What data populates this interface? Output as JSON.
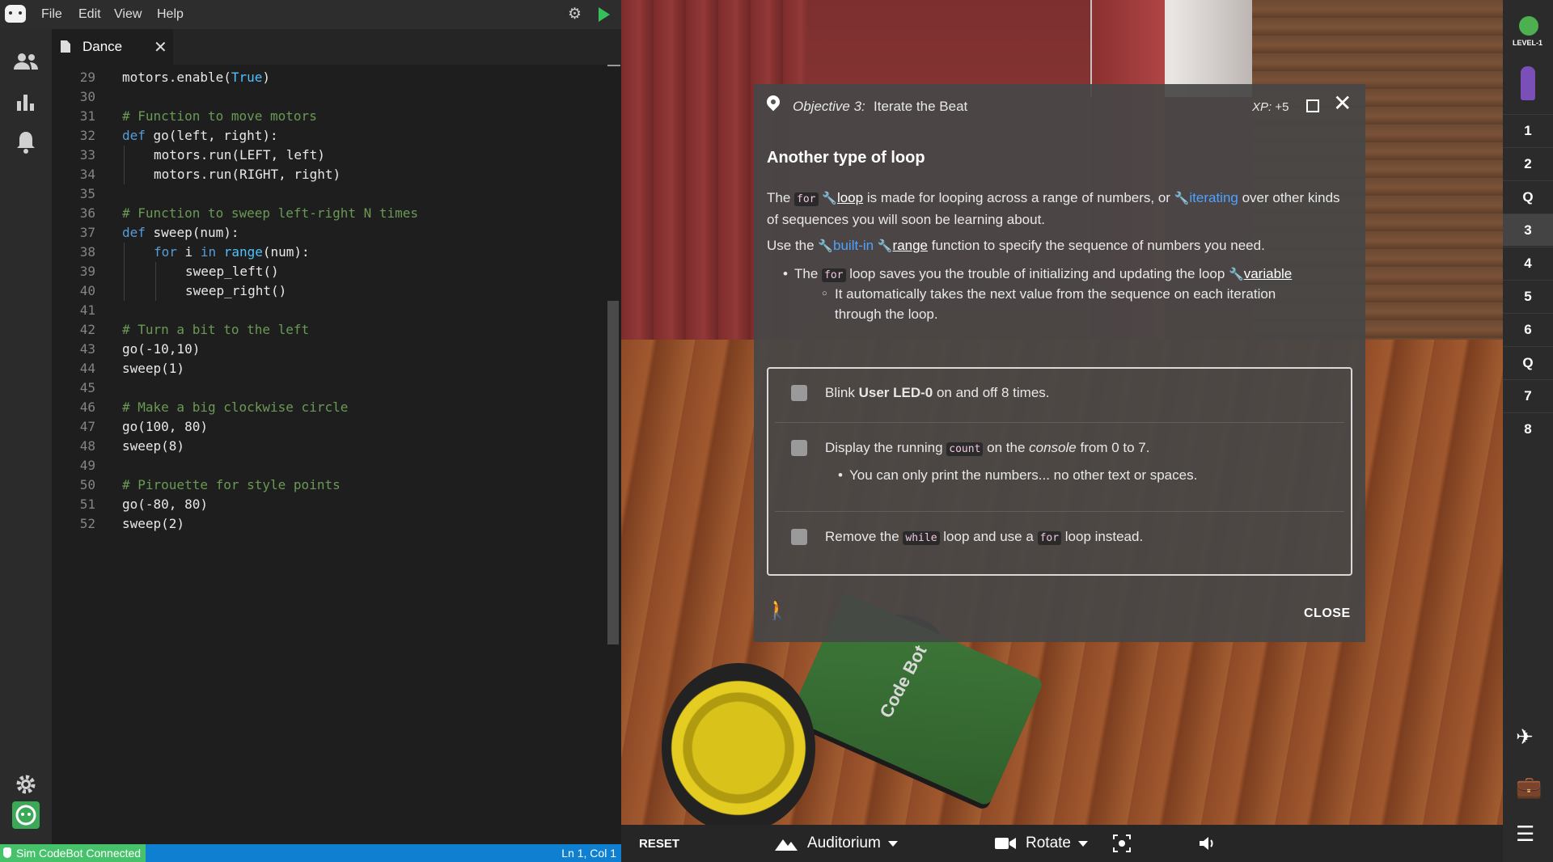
{
  "menubar": {
    "items": [
      "File",
      "Edit",
      "View",
      "Help"
    ]
  },
  "editor": {
    "tab_title": "Dance",
    "lines": [
      {
        "n": "29",
        "segs": [
          [
            "",
            "motors.enable("
          ],
          [
            "bi",
            "True"
          ],
          [
            "",
            ")"
          ]
        ],
        "indent": 0
      },
      {
        "n": "30",
        "segs": [],
        "indent": 0
      },
      {
        "n": "31",
        "segs": [
          [
            "cm",
            "# Function to move motors"
          ]
        ],
        "indent": 0
      },
      {
        "n": "32",
        "segs": [
          [
            "kw",
            "def"
          ],
          [
            "",
            " go(left, right):"
          ]
        ],
        "indent": 0
      },
      {
        "n": "33",
        "segs": [
          [
            "",
            "motors.run(LEFT, left)"
          ]
        ],
        "indent": 1
      },
      {
        "n": "34",
        "segs": [
          [
            "",
            "motors.run(RIGHT, right)"
          ]
        ],
        "indent": 1
      },
      {
        "n": "35",
        "segs": [],
        "indent": 0
      },
      {
        "n": "36",
        "segs": [
          [
            "cm",
            "# Function to sweep left-right N times"
          ]
        ],
        "indent": 0
      },
      {
        "n": "37",
        "segs": [
          [
            "kw",
            "def"
          ],
          [
            "",
            " sweep(num):"
          ]
        ],
        "indent": 0
      },
      {
        "n": "38",
        "segs": [
          [
            "kw",
            "for"
          ],
          [
            "",
            " i "
          ],
          [
            "kw",
            "in"
          ],
          [
            "",
            " "
          ],
          [
            "bi",
            "range"
          ],
          [
            "",
            "(num):"
          ]
        ],
        "indent": 1
      },
      {
        "n": "39",
        "segs": [
          [
            "",
            "sweep_left()"
          ]
        ],
        "indent": 2
      },
      {
        "n": "40",
        "segs": [
          [
            "",
            "sweep_right()"
          ]
        ],
        "indent": 2
      },
      {
        "n": "41",
        "segs": [],
        "indent": 0
      },
      {
        "n": "42",
        "segs": [
          [
            "cm",
            "# Turn a bit to the left"
          ]
        ],
        "indent": 0
      },
      {
        "n": "43",
        "segs": [
          [
            "",
            "go(-10,10)"
          ]
        ],
        "indent": 0
      },
      {
        "n": "44",
        "segs": [
          [
            "",
            "sweep(1)"
          ]
        ],
        "indent": 0
      },
      {
        "n": "45",
        "segs": [],
        "indent": 0
      },
      {
        "n": "46",
        "segs": [
          [
            "cm",
            "# Make a big clockwise circle"
          ]
        ],
        "indent": 0
      },
      {
        "n": "47",
        "segs": [
          [
            "",
            "go(100, 80)"
          ]
        ],
        "indent": 0
      },
      {
        "n": "48",
        "segs": [
          [
            "",
            "sweep(8)"
          ]
        ],
        "indent": 0
      },
      {
        "n": "49",
        "segs": [],
        "indent": 0
      },
      {
        "n": "50",
        "segs": [
          [
            "cm",
            "# Pirouette for style points"
          ]
        ],
        "indent": 0
      },
      {
        "n": "51",
        "segs": [
          [
            "",
            "go(-80, 80)"
          ]
        ],
        "indent": 0
      },
      {
        "n": "52",
        "segs": [
          [
            "",
            "sweep(2)"
          ]
        ],
        "indent": 0
      }
    ]
  },
  "status": {
    "connection": "Sim CodeBot Connected",
    "position": "Ln 1, Col 1"
  },
  "objective": {
    "number_label": "Objective 3:",
    "title": "Iterate the Beat",
    "xp_label": "XP:",
    "xp_value": "+5",
    "heading": "Another type of loop",
    "p1_a": "The",
    "code_for": "for",
    "link_loop": "loop",
    "p1_b": "is made for looping across a range of numbers, or",
    "link_iterating": "iterating",
    "p1_c": "over other kinds of sequences you will soon be learning about.",
    "p2_a": "Use the",
    "link_builtin": "built-in",
    "link_range": "range",
    "p2_b": "function to specify the sequence of numbers you need.",
    "b1_a": "The",
    "b1_b": "loop saves you the trouble of initializing and updating the loop",
    "link_variable": "variable",
    "b1_sub": "It automatically takes the next value from the sequence on each iteration through the loop.",
    "task1_a": "Blink",
    "task1_bold": "User LED-0",
    "task1_b": "on and off 8 times.",
    "task2_a": "Display the running",
    "task2_code": "count",
    "task2_b": "on the",
    "task2_em": "console",
    "task2_c": "from 0 to 7.",
    "task2_sub": "You can only print the numbers... no other text or spaces.",
    "task3_a": "Remove the",
    "task3_code": "while",
    "task3_b": "loop and use a",
    "task3_code2": "for",
    "task3_c": "loop instead.",
    "close_label": "CLOSE"
  },
  "scene_toolbar": {
    "reset": "RESET",
    "environment": "Auditorium",
    "camera": "Rotate"
  },
  "scene": {
    "board_label": "Code Bot"
  },
  "rail": {
    "level": "LEVEL-1",
    "steps": [
      "1",
      "2",
      "Q",
      "3",
      "4",
      "5",
      "6",
      "Q",
      "7",
      "8"
    ],
    "active_step": "3"
  }
}
